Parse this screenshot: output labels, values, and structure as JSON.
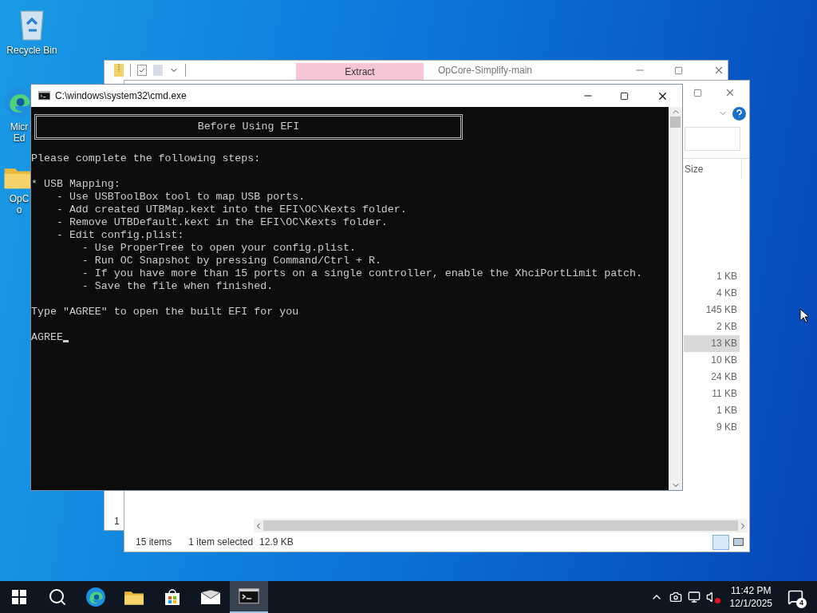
{
  "desktop_icons": [
    {
      "kind": "bin",
      "label": "Recycle Bin"
    },
    {
      "kind": "edge",
      "label": "Micr Ed"
    },
    {
      "kind": "folder",
      "label": "OpCo"
    }
  ],
  "archive_window": {
    "tab": "Extract",
    "title": "OpCore-Simplify-main",
    "status_fragment": "1"
  },
  "explorer": {
    "column": "Size",
    "rows": [
      {
        "size": "1 KB",
        "selected": false
      },
      {
        "size": "4 KB",
        "selected": false
      },
      {
        "size": "145 KB",
        "selected": false
      },
      {
        "size": "2 KB",
        "selected": false
      },
      {
        "size": "13 KB",
        "selected": true
      },
      {
        "size": "10 KB",
        "selected": false
      },
      {
        "size": "24 KB",
        "selected": false
      },
      {
        "size": "11 KB",
        "selected": false
      },
      {
        "size": "1 KB",
        "selected": false
      },
      {
        "size": "9 KB",
        "selected": false
      }
    ],
    "status": {
      "count": "15 items",
      "selection": "1 item selected",
      "size": "12.9 KB"
    }
  },
  "cmd": {
    "title": "C:\\windows\\system32\\cmd.exe",
    "banner": "Before Using EFI",
    "blocks": [
      [
        "Please complete the following steps:"
      ],
      [
        "* USB Mapping:",
        "    - Use USBToolBox tool to map USB ports.",
        "    - Add created UTBMap.kext into the EFI\\OC\\Kexts folder.",
        "    - Remove UTBDefault.kext in the EFI\\OC\\Kexts folder.",
        "    - Edit config.plist:",
        "        - Use ProperTree to open your config.plist.",
        "        - Run OC Snapshot by pressing Command/Ctrl + R.",
        "        - If you have more than 15 ports on a single controller, enable the XhciPortLimit patch.",
        "        - Save the file when finished."
      ],
      [
        "Type \"AGREE\" to open the built EFI for you"
      ]
    ],
    "input": "AGREE"
  },
  "taskbar": {
    "apps": [
      {
        "kind": "start",
        "selected": false
      },
      {
        "kind": "search",
        "selected": false
      },
      {
        "kind": "edge",
        "selected": false
      },
      {
        "kind": "explorer",
        "selected": false
      },
      {
        "kind": "store",
        "selected": false
      },
      {
        "kind": "mail",
        "selected": false
      },
      {
        "kind": "cmd",
        "selected": true
      }
    ],
    "time": "11:42 PM",
    "date": "12/1/2025",
    "notifications": "4"
  }
}
